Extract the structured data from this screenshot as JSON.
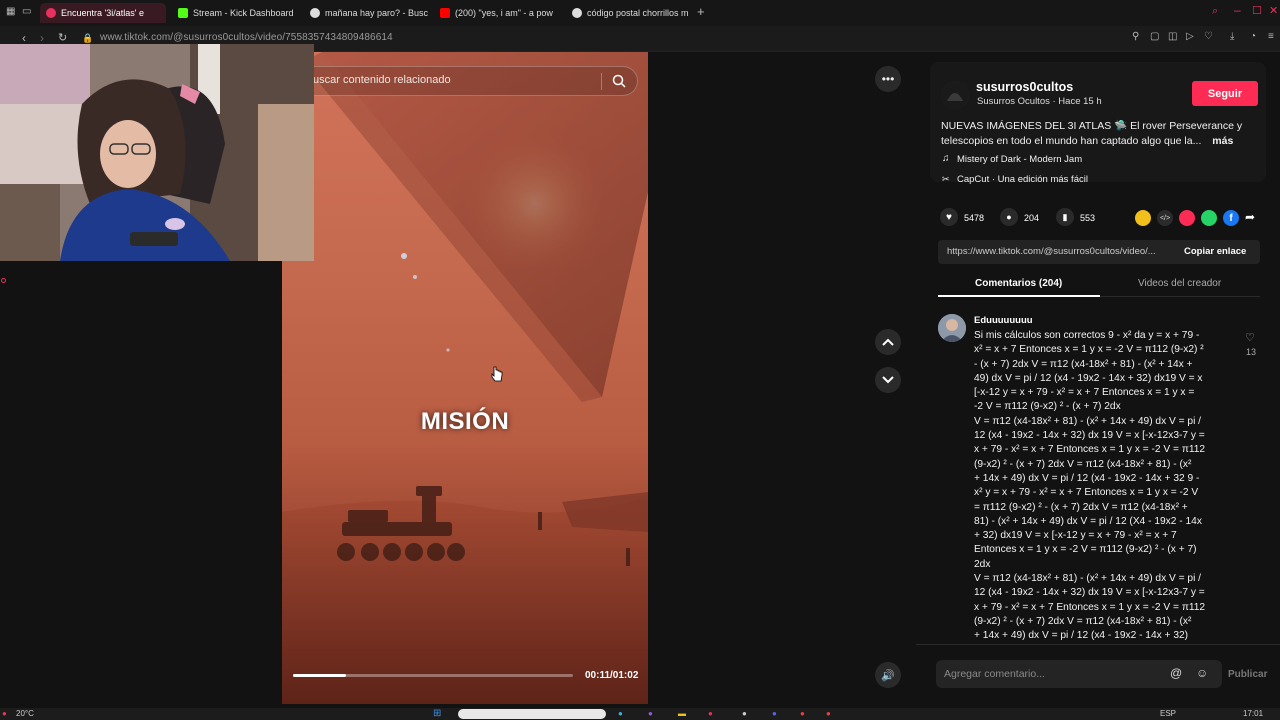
{
  "browser": {
    "tabs": [
      {
        "title": "Encuentra '3i/atlas' e",
        "active": true,
        "color": "#e8315d"
      },
      {
        "title": "Stream - Kick Dashboard",
        "active": false,
        "color": "#53fc18"
      },
      {
        "title": "mañana hay paro? - Busc",
        "active": false,
        "color": "#dddddd"
      },
      {
        "title": "(200) \"yes, i am\" - a pow",
        "active": false,
        "color": "#ff0000"
      },
      {
        "title": "código postal chorrillos m",
        "active": false,
        "color": "#dddddd"
      }
    ],
    "new_tab": "+",
    "url": "www.tiktok.com/@susurros0cultos/video/7558357434809486614"
  },
  "video": {
    "search_placeholder": "uscar contenido relacionado",
    "caption": "MISIÓN",
    "timecode": "00:11/01:02",
    "progress": 0.19
  },
  "post": {
    "username": "susurros0cultos",
    "subtitle": "Susurros Ocultos · Hace 15 h",
    "follow_label": "Seguir",
    "description": "NUEVAS IMÁGENES DEL 3I ATLAS 🛸 El rover Perseverance y telescopios en todo el mundo han captado algo que la...",
    "more_label": "más",
    "music": "Mistery of Dark - Modern Jam",
    "capcut": "CapCut · Una edición más fácil",
    "likes": "5478",
    "comments": "204",
    "saves": "553",
    "share_url": "https://www.tiktok.com/@susurros0cultos/video/...",
    "copy_label": "Copiar enlace",
    "tab_comments": "Comentarios (204)",
    "tab_creator": "Videos del creador"
  },
  "comment": {
    "author": "Eduuuuuuuu",
    "likes": "13",
    "text_lines": [
      "Si mis cálculos son correctos 9 - x² da y = x + 79 -",
      "x² = x + 7 Entonces x = 1 y x = -2 V = π112 (9-x2) ²",
      "- (x + 7) 2dx V = π12 (x4-18x² + 81) - (x² + 14x +",
      "49) dx V = pi / 12 (x4 - 19x2 - 14x + 32) dx19 V = x",
      "[-x-12 y = x + 79 - x² = x + 7 Entonces x = 1 y x =",
      "-2 V = π112 (9-x2) ² - (x + 7) 2dx",
      "V = π12 (x4-18x² + 81) - (x² + 14x + 49) dx V = pi /",
      "12 (x4 - 19x2 - 14x + 32) dx 19 V = x [-x-12x3-7 y =",
      "x + 79 - x² = x + 7 Entonces x = 1 y x = -2 V = π112",
      "(9-x2) ² - (x + 7) 2dx V = π12 (x4-18x² + 81) - (x²",
      "+ 14x + 49) dx V = pi / 12 (x4 - 19x2 - 14x + 32 9 -",
      "x² y = x + 79 - x² = x + 7 Entonces x = 1 y x = -2 V",
      "= π112 (9-x2) ² - (x + 7) 2dx V = π12 (x4-18x² +",
      "81) - (x² + 14x + 49) dx V = pi / 12 (X4 - 19x2 - 14x",
      "+ 32) dx19 V = x [-x-12 y = x + 79 - x² = x + 7",
      "Entonces x = 1 y x = -2 V = π112 (9-x2) ² - (x + 7)",
      "2dx",
      "V = π12 (x4-18x² + 81) - (x² + 14x + 49) dx V = pi /",
      "12 (x4 - 19x2 - 14x + 32) dx 19 V = x [-x-12x3-7 y =",
      "x + 79 - x² = x + 7 Entonces x = 1 y x = -2 V = π112",
      "(9-x2) ² - (x + 7) 2dx V = π12 (x4-18x² + 81) - (x²",
      "+ 14x + 49) dx V = pi / 12 (x4 - 19x2 - 14x + 32)"
    ]
  },
  "composer": {
    "placeholder": "Agregar comentario...",
    "publish_label": "Publicar"
  },
  "taskbar": {
    "weather": "20°C",
    "language": "ESP",
    "time": "17:01"
  }
}
